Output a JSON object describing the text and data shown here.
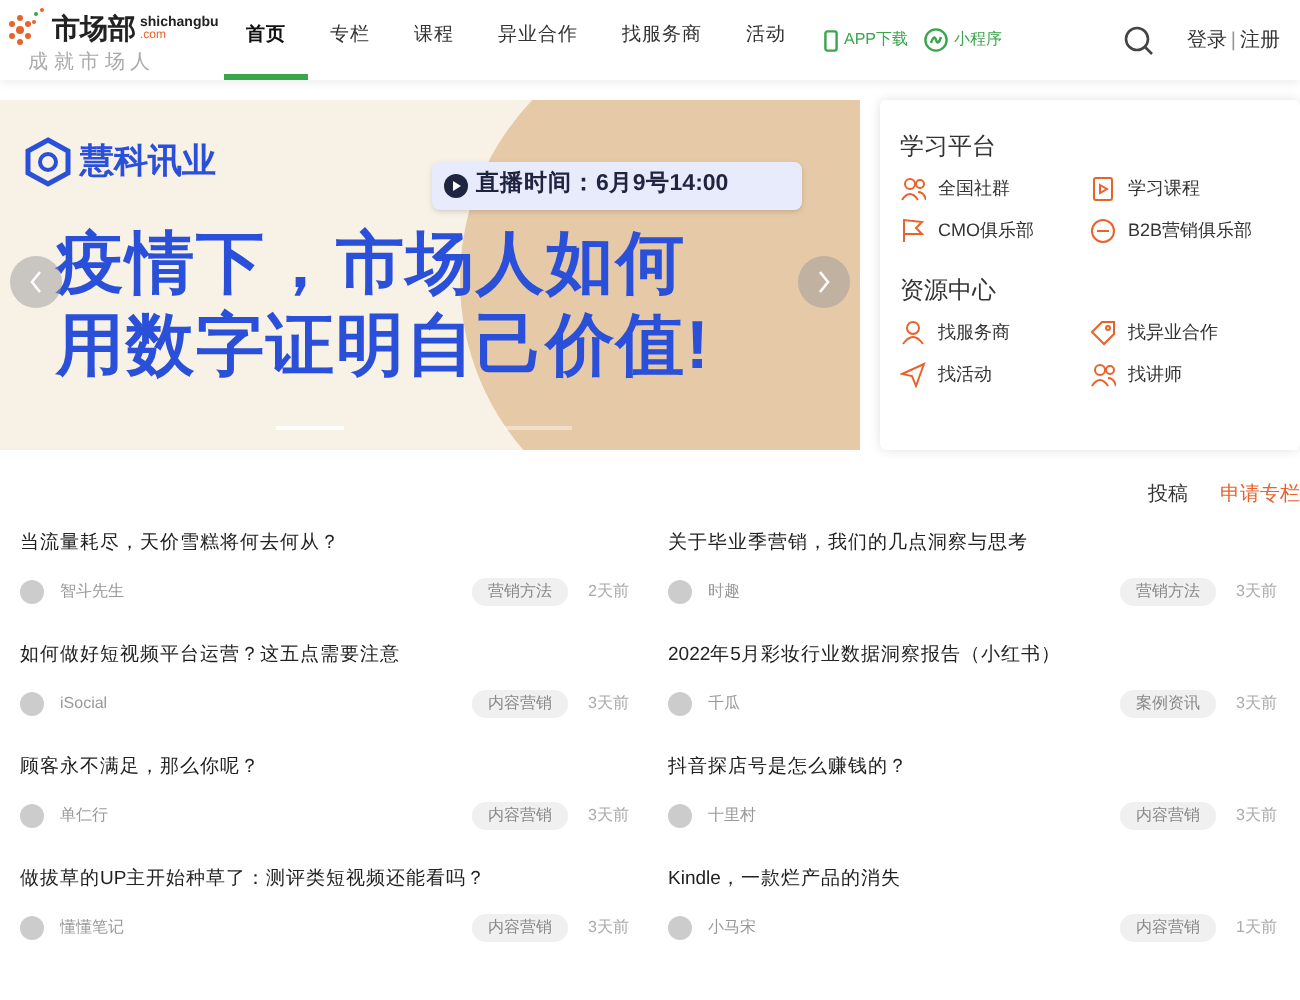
{
  "logo": {
    "name": "市场部",
    "domain": "shichangbu",
    "tld": ".com",
    "slogan": "成 就 市 场 人"
  },
  "nav": [
    {
      "label": "首页",
      "selected": true
    },
    {
      "label": "专栏",
      "selected": false
    },
    {
      "label": "课程",
      "selected": false
    },
    {
      "label": "异业合作",
      "selected": false
    },
    {
      "label": "找服务商",
      "selected": false
    },
    {
      "label": "活动",
      "selected": false
    }
  ],
  "app_links": [
    {
      "kind": "phone",
      "label": "APP下载"
    },
    {
      "kind": "mini",
      "label": "小程序"
    }
  ],
  "auth": {
    "login": "登录",
    "separator": "|",
    "register": "注册"
  },
  "banner": {
    "brand": "慧科讯业",
    "live_time": "直播时间：6月9号14:00",
    "headline": [
      "疫情下，市场人如何",
      "用数字证明自己价值!"
    ],
    "dots": [
      {
        "selected": true
      },
      {
        "selected": false
      }
    ]
  },
  "side_panel": [
    {
      "title": "学习平台",
      "links": [
        {
          "kind": "people",
          "label": "全国社群"
        },
        {
          "kind": "play",
          "label": "学习课程"
        },
        {
          "kind": "flag",
          "label": "CMO俱乐部"
        },
        {
          "kind": "b2b",
          "label": "B2B营销俱乐部"
        }
      ]
    },
    {
      "title": "资源中心",
      "links": [
        {
          "kind": "person",
          "label": "找服务商"
        },
        {
          "kind": "tag",
          "label": "找异业合作"
        },
        {
          "kind": "send",
          "label": "找活动"
        },
        {
          "kind": "people",
          "label": "找讲师"
        }
      ]
    }
  ],
  "actions": [
    {
      "label": "投稿",
      "kind": "plain"
    },
    {
      "label": "申请专栏",
      "kind": "accent"
    }
  ],
  "articles": [
    {
      "title": "当流量耗尽，天价雪糕将何去何从？",
      "author": "智斗先生",
      "tag": "营销方法",
      "time": "2天前"
    },
    {
      "title": "关于毕业季营销，我们的几点洞察与思考",
      "author": "时趣",
      "tag": "营销方法",
      "time": "3天前"
    },
    {
      "title": "如何做好短视频平台运营？这五点需要注意",
      "author": "iSocial",
      "tag": "内容营销",
      "time": "3天前"
    },
    {
      "title": "2022年5月彩妆行业数据洞察报告（小红书）",
      "author": "千瓜",
      "tag": "案例资讯",
      "time": "3天前"
    },
    {
      "title": "顾客永不满足，那么你呢？",
      "author": "单仁行",
      "tag": "内容营销",
      "time": "3天前"
    },
    {
      "title": "抖音探店号是怎么赚钱的？",
      "author": "十里村",
      "tag": "内容营销",
      "time": "3天前"
    },
    {
      "title": "做拔草的UP主开始种草了：测评类短视频还能看吗？",
      "author": "懂懂笔记",
      "tag": "内容营销",
      "time": "3天前"
    },
    {
      "title": "Kindle，一款烂产品的消失",
      "author": "小马宋",
      "tag": "内容营销",
      "time": "1天前"
    }
  ]
}
